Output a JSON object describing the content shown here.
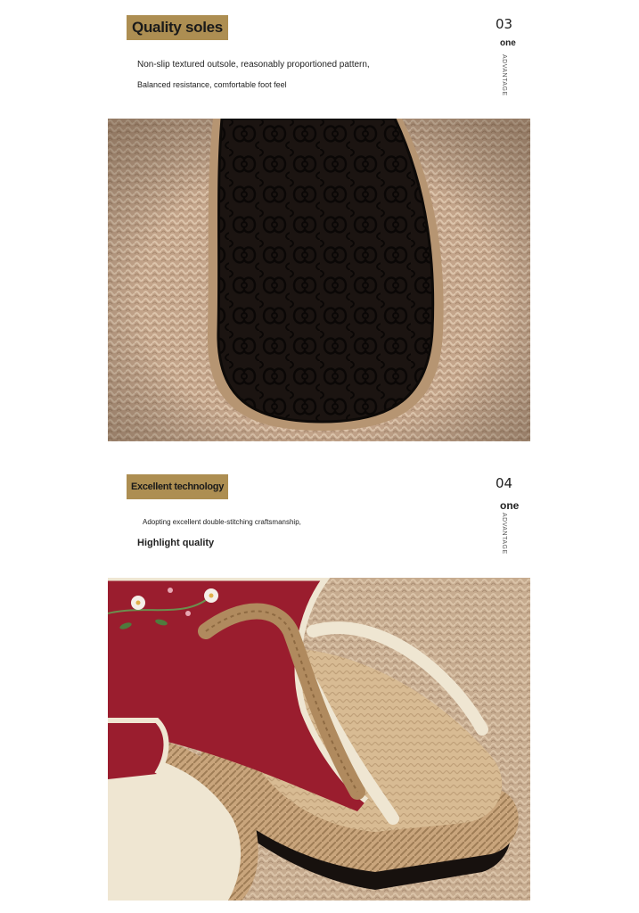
{
  "sections": [
    {
      "tag": "Quality soles",
      "number": "03",
      "small": "one",
      "vertical": "ADVANTAGE",
      "lines": [
        "Non-slip textured outsole, reasonably proportioned pattern,",
        "Balanced resistance, comfortable foot feel"
      ],
      "photo_icon": "shoe-sole-photo"
    },
    {
      "tag": "Excellent technology",
      "number": "04",
      "small": "one",
      "vertical": "ADVANTAGE",
      "lines": [
        "Adopting excellent double-stitching craftsmanship,",
        "Highlight quality"
      ],
      "photo_icon": "embroidered-slipper-photo"
    }
  ],
  "colors": {
    "tag_bg": "#ad8e52",
    "jute": "#c8aa88",
    "sole": "#1c1512",
    "fabric": "#9a1d2e",
    "piping": "#efe6d2"
  }
}
